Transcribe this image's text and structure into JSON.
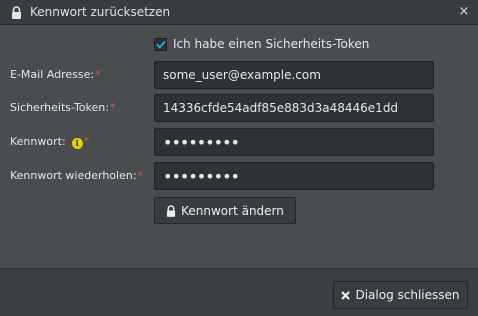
{
  "dialog": {
    "title": "Kennwort zurücksetzen",
    "close_glyph": "×",
    "lock_icon": "lock-icon"
  },
  "form": {
    "has_token": {
      "label": "Ich habe einen Sicherheits-Token",
      "checked": true
    },
    "email": {
      "label": "E-Mail Adresse:",
      "value": "some_user@example.com"
    },
    "token": {
      "label": "Sicherheits-Token:",
      "value": "14336cfde54adf85e883d3a48446e1dd"
    },
    "password": {
      "label": "Kennwort:",
      "info_glyph": "i",
      "value": "•••••••••"
    },
    "password_repeat": {
      "label": "Kennwort wiederholen:",
      "value": "•••••••••"
    },
    "required_marker": "*"
  },
  "buttons": {
    "change_password": "Kennwort ändern",
    "close_dialog": "Dialog schliessen"
  },
  "colors": {
    "accent": "#2aa3d8",
    "required": "#d9534f",
    "info": "#e5d200"
  }
}
